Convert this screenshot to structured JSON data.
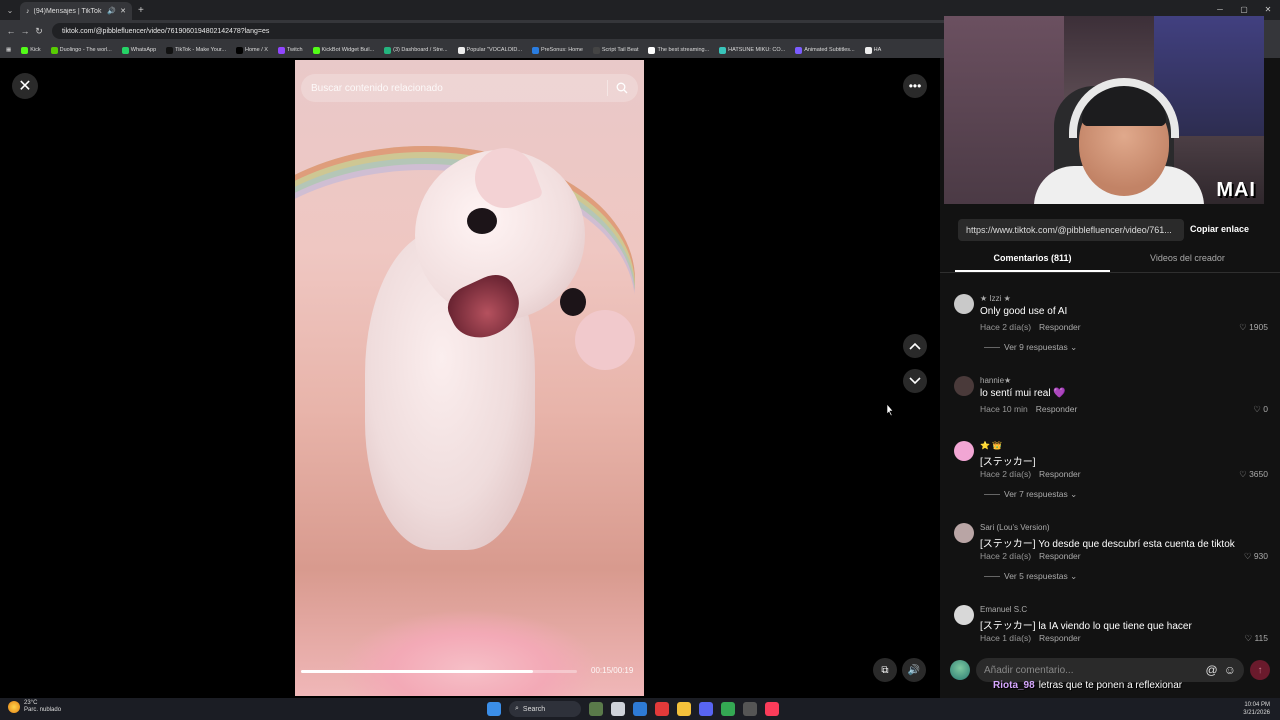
{
  "browser": {
    "tab_title": "(94)Mensajes | TikTok",
    "url": "tiktok.com/@pibblefluencer/video/7619060194802142478?lang=es",
    "bookmarks": [
      {
        "label": "Kick",
        "color": "#53fc18"
      },
      {
        "label": "Duolingo - The worl...",
        "color": "#58cc02"
      },
      {
        "label": "WhatsApp",
        "color": "#25d366"
      },
      {
        "label": "TikTok - Make Your...",
        "color": "#111111"
      },
      {
        "label": "Home / X",
        "color": "#000000"
      },
      {
        "label": "Twitch",
        "color": "#9146ff"
      },
      {
        "label": "KickBot Widget Buil...",
        "color": "#53fc18"
      },
      {
        "label": "(3) Dashboard / Stre...",
        "color": "#24b47e"
      },
      {
        "label": "Popular \"VOCALOID...",
        "color": "#eeeeee"
      },
      {
        "label": "PreSonus: Home",
        "color": "#2a7de1"
      },
      {
        "label": "Script Tail Beat",
        "color": "#444444"
      },
      {
        "label": "The best streaming...",
        "color": "#ffffff"
      },
      {
        "label": "HATSUNE MIKU: CO...",
        "color": "#39c5bb"
      },
      {
        "label": "Animated Subtitles...",
        "color": "#7b5cff"
      },
      {
        "label": "HA",
        "color": "#eeeeee"
      }
    ]
  },
  "video": {
    "search_placeholder": "Buscar contenido relacionado",
    "timecode": "00:15/00:19",
    "progress": 0.84
  },
  "panel": {
    "webcam_logo": "MAI",
    "share_url": "https://www.tiktok.com/@pibblefluencer/video/761...",
    "copy_link": "Copiar enlace",
    "tab_comments": "Comentarios (811)",
    "tab_videos": "Videos del creador",
    "comments": [
      {
        "user": "★ Izzi ★",
        "text": "Only good use of AI",
        "time": "Hace 2 día(s)",
        "reply": "Responder",
        "likes": "1905",
        "replies": "Ver 9 respuestas",
        "avatar": "#c9c9c9"
      },
      {
        "user": "hannie★",
        "text": "lo sentí mui real 💜",
        "time": "Hace 10 min",
        "reply": "Responder",
        "likes": "0",
        "replies": "",
        "avatar": "#4a3a3a"
      },
      {
        "user": "⭐ 👑",
        "text": "[ステッカー]",
        "time": "Hace 2 día(s)",
        "reply": "Responder",
        "likes": "3650",
        "replies": "Ver 7 respuestas",
        "avatar": "#f2a6d4"
      },
      {
        "user": "Sari (Lou's Version)",
        "text": "[ステッカー] Yo desde que descubrí esta cuenta de tiktok",
        "time": "Hace 2 día(s)",
        "reply": "Responder",
        "likes": "930",
        "replies": "Ver 5 respuestas",
        "avatar": "#b9a5a5"
      },
      {
        "user": "Emanuel S.C",
        "text": "[ステッカー] la IA viendo lo que tiene que hacer",
        "time": "Hace 1 día(s)",
        "reply": "Responder",
        "likes": "115",
        "replies": "",
        "avatar": "#d8d8d8"
      }
    ],
    "comment_placeholder": "Añadir comentario...",
    "chat": {
      "name": "Riota_98",
      "message": "letras que te ponen a reflexionar"
    }
  },
  "taskbar": {
    "temperature": "23°C",
    "weather": "Parc. nublado",
    "search": "Search",
    "time": "10:04 PM",
    "date": "3/21/2026"
  }
}
